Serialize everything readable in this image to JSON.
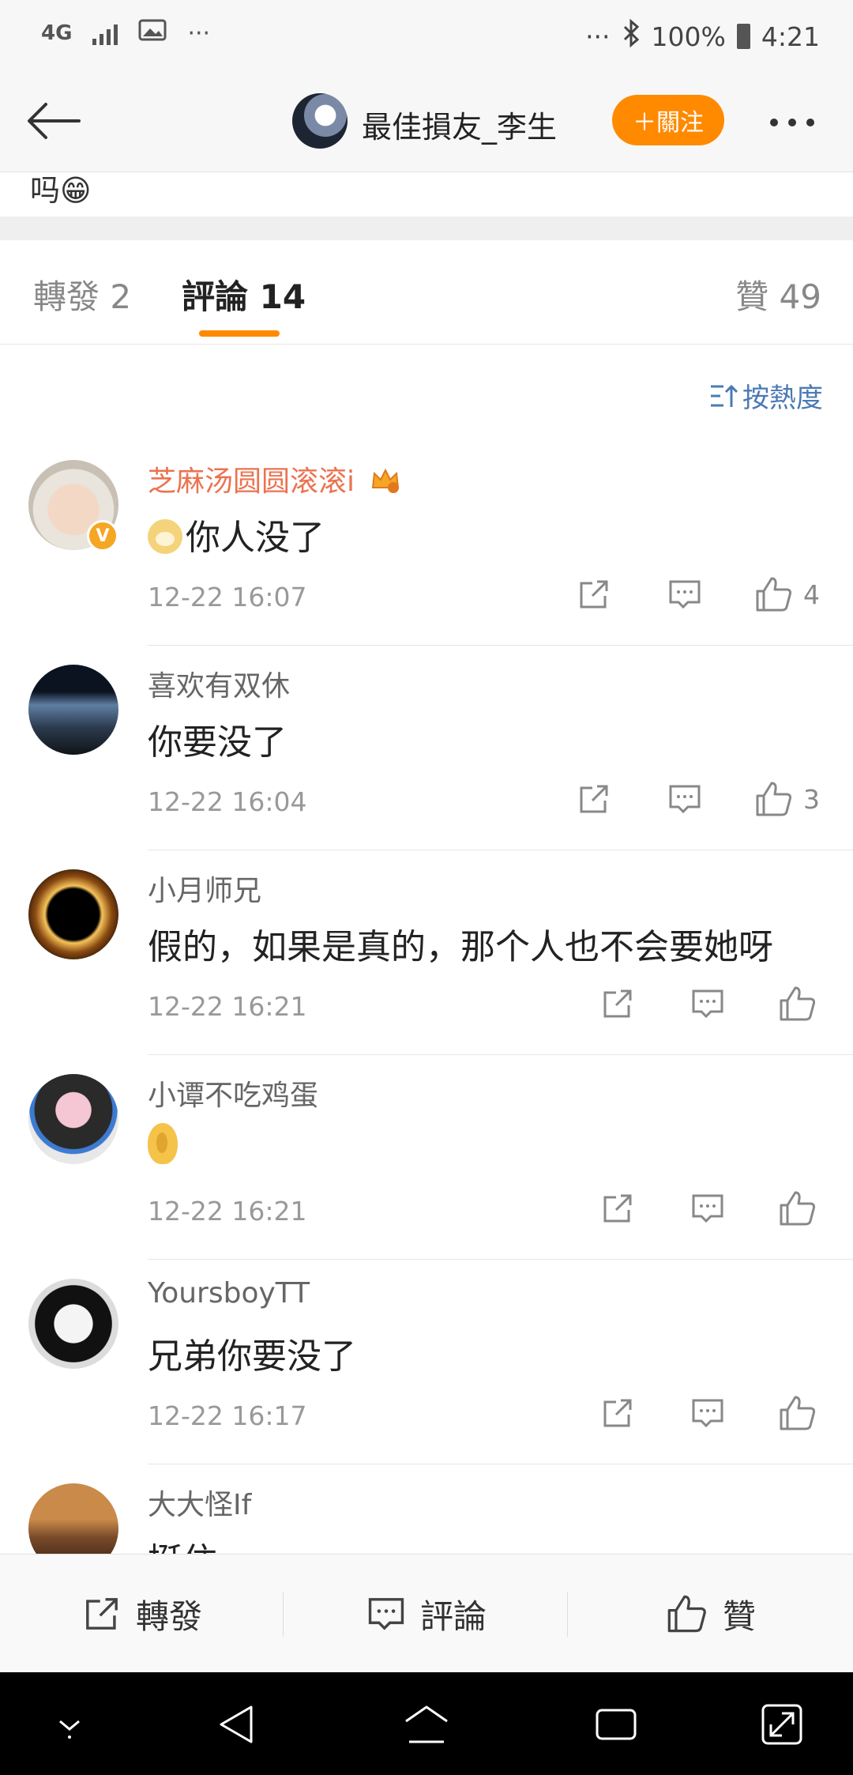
{
  "status_bar": {
    "network": "4G",
    "overflow": "···",
    "right_overflow": "···",
    "battery": "100%",
    "time": "4:21",
    "icons": [
      "signal-icon",
      "image-icon",
      "bluetooth-icon",
      "battery-icon"
    ]
  },
  "nav": {
    "username": "最佳損友_李生",
    "follow_label": "＋關注"
  },
  "post_tail_text": "吗😁",
  "tabs": {
    "reposts": "轉發 2",
    "comments": "評論 14",
    "likes": "贊 49"
  },
  "sort_label": "按熱度",
  "comments": [
    {
      "name": "芝麻汤圆圆滚滚i",
      "text": "你人没了",
      "time": "12-22 16:07",
      "likes": "4",
      "verified": true,
      "vip": true
    },
    {
      "name": "喜欢有双休",
      "text": "你要没了",
      "time": "12-22 16:04",
      "likes": "3"
    },
    {
      "name": "小月师兄",
      "text": "假的，如果是真的，那个人也不会要她呀",
      "time": "12-22 16:21",
      "likes": ""
    },
    {
      "name": "小谭不吃鸡蛋",
      "text": "",
      "time": "12-22 16:21",
      "likes": ""
    },
    {
      "name": "YoursboyTT",
      "text": "兄弟你要没了",
      "time": "12-22 16:17",
      "likes": ""
    },
    {
      "name": "大大怪If",
      "text": "挺住",
      "time": "",
      "likes": ""
    }
  ],
  "bottom_bar": {
    "repost": "轉發",
    "comment": "評論",
    "like": "贊"
  },
  "colors": {
    "accent": "#ff8a00",
    "vip_name": "#eb7350",
    "link_blue": "#4b7ab4"
  }
}
